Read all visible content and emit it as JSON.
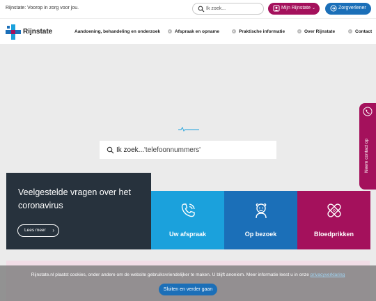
{
  "topbar": {
    "tagline": "Rijnstate: Voorop in zorg voor jou.",
    "search_placeholder": "Ik zoek...",
    "mijn_label": "Mijn Rijnstate",
    "zorg_label": "Zorgverlener"
  },
  "brand": {
    "name": "Rijnstate",
    "colors": {
      "blue": "#1b6fb8",
      "light_blue": "#1ba1dc",
      "magenta": "#a4115c",
      "dark": "#27323d"
    }
  },
  "nav": {
    "items": [
      {
        "label": "Aandoening, behandeling en onderzoek",
        "has_icon": false
      },
      {
        "label": "Afspraak en opname",
        "has_icon": true
      },
      {
        "label": "Praktische informatie",
        "has_icon": true
      },
      {
        "label": "Over Rijnstate",
        "has_icon": true
      },
      {
        "label": "Contact",
        "has_icon": true
      }
    ]
  },
  "hero": {
    "search_label": "Ik zoek...",
    "search_typed": "'telefoonnummers'"
  },
  "side_tab": {
    "label": "Neem contact op"
  },
  "corona_card": {
    "title": "Veelgestelde vragen over het coronavirus",
    "button": "Lees meer"
  },
  "tiles": [
    {
      "label": "Uw afspraak",
      "icon": "phone-icon"
    },
    {
      "label": "Op bezoek",
      "icon": "visitor-icon"
    },
    {
      "label": "Bloedprikken",
      "icon": "bandage-icon"
    }
  ],
  "cookie": {
    "message": "Rijnstate.nl plaatst cookies, onder andere om de website gebruiksvriendelijker te maken. U blijft anoniem. Meer informatie leest u in onze",
    "link": "privacyverklaring",
    "button": "Sluiten en verder gaan"
  }
}
